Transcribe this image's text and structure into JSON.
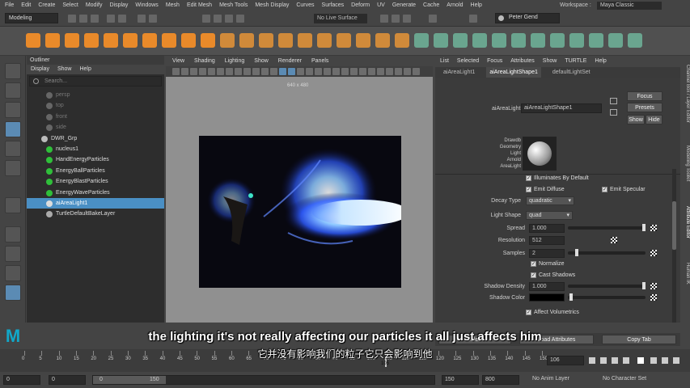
{
  "menubar": {
    "items": [
      "File",
      "Edit",
      "Create",
      "Select",
      "Modify",
      "Display",
      "Windows",
      "Mesh",
      "Edit Mesh",
      "Mesh Tools",
      "Mesh Display",
      "Curves",
      "Surfaces",
      "Deform",
      "UV",
      "Generate",
      "Cache",
      "Arnold",
      "Help"
    ],
    "workspace_label": "Workspace :",
    "workspace_value": "Maya Classic"
  },
  "statusline": {
    "mode": "Modeling",
    "live_surface": "No Live Surface",
    "user": "Peter Gend"
  },
  "outliner": {
    "title": "Outliner",
    "menu": [
      "Display",
      "Show",
      "Help"
    ],
    "search_placeholder": "Search...",
    "items": [
      {
        "label": "persp",
        "state": "dim",
        "icon_color": "#666"
      },
      {
        "label": "top",
        "state": "dim",
        "icon_color": "#666"
      },
      {
        "label": "front",
        "state": "dim",
        "icon_color": "#666"
      },
      {
        "label": "side",
        "state": "dim",
        "icon_color": "#666"
      },
      {
        "label": "DWR_Grp",
        "state": "normal",
        "icon_color": "#bbb"
      },
      {
        "label": "nucleus1",
        "state": "normal",
        "icon_color": "#2fbf3a"
      },
      {
        "label": "HandEnergyParticles",
        "state": "normal",
        "icon_color": "#2fbf3a"
      },
      {
        "label": "EnergyBallParticles",
        "state": "normal",
        "icon_color": "#2fbf3a"
      },
      {
        "label": "EnergyBlastParticles",
        "state": "normal",
        "icon_color": "#2fbf3a"
      },
      {
        "label": "EnergyWaveParticles",
        "state": "normal",
        "icon_color": "#2fbf3a"
      },
      {
        "label": "aiAreaLight1",
        "state": "selected",
        "icon_color": "#ddd"
      },
      {
        "label": "TurtleDefaultBakeLayer",
        "state": "normal",
        "icon_color": "#aaa"
      }
    ]
  },
  "viewport": {
    "menu": [
      "View",
      "Shading",
      "Lighting",
      "Show",
      "Renderer",
      "Panels"
    ],
    "resolution": "640 x 480"
  },
  "attribute_editor": {
    "menu": [
      "List",
      "Selected",
      "Focus",
      "Attributes",
      "Show",
      "TURTLE",
      "Help"
    ],
    "tabs": [
      "aiAreaLight1",
      "aiAreaLightShape1",
      "defaultLightSet"
    ],
    "active_tab": "aiAreaLightShape1",
    "node_label": "aiAreaLight:",
    "node_value": "aiAreaLightShape1",
    "buttons": {
      "focus": "Focus",
      "presets": "Presets",
      "show": "Show",
      "hide": "Hide"
    },
    "swatch_caption": [
      "Drawdb",
      "Geometry",
      "Light",
      "Arnold",
      "AreaLight"
    ],
    "illuminates_by_default": "Illuminates By Default",
    "emit_diffuse": "Emit Diffuse",
    "emit_specular": "Emit Specular",
    "decay_type_label": "Decay Type",
    "decay_type_value": "quadratic",
    "light_shape_label": "Light Shape",
    "light_shape_value": "quad",
    "spread_label": "Spread",
    "spread_value": "1.000",
    "spread_fraction": 1.0,
    "resolution_label": "Resolution",
    "resolution_value": "512",
    "samples_label": "Samples",
    "samples_value": "2",
    "samples_fraction": 0.1,
    "normalize": "Normalize",
    "cast_shadows": "Cast Shadows",
    "shadow_density_label": "Shadow Density",
    "shadow_density_value": "1.000",
    "shadow_density_fraction": 1.0,
    "shadow_color_label": "Shadow Color",
    "affect_volumetrics": "Affect Volumetrics",
    "bottom_buttons": {
      "select": "Select",
      "load": "Load Attributes",
      "copy": "Copy Tab"
    }
  },
  "side_tabs": [
    "Channel Box / Layer Editor",
    "Modelling Toolkit",
    "Attribute Editor",
    "Human IK"
  ],
  "timeline": {
    "ticks": [
      "0",
      "5",
      "10",
      "15",
      "20",
      "25",
      "30",
      "35",
      "40",
      "45",
      "50",
      "55",
      "60",
      "65",
      "70",
      "75",
      "80",
      "85",
      "90",
      "95",
      "100",
      "105",
      "110",
      "115",
      "120",
      "125",
      "130",
      "135",
      "140",
      "145",
      "150"
    ],
    "current_frame": "106",
    "cursor_label": "105"
  },
  "range": {
    "start": "0",
    "start_anim": "0",
    "range_start": "0",
    "range_end": "150",
    "end": "150",
    "end_anim": "800",
    "anim_layer": "No Anim Layer",
    "char_set": "No Character Set"
  },
  "subtitles": {
    "en": "the lighting it's not really affecting our particles it all just affects him",
    "zh": "它并没有影响我们的粒子它只会影响到他"
  },
  "colors": {
    "maya_accent": "#11a8c9",
    "selection": "#4a8fc4",
    "shelf_orange": "#e98a2a"
  }
}
